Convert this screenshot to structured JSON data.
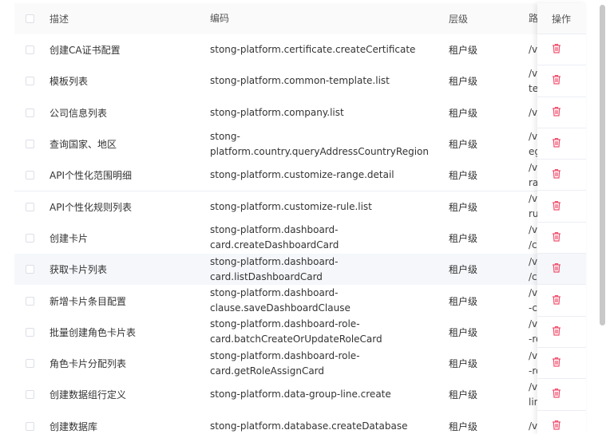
{
  "columns": {
    "description": "描述",
    "code": "编码",
    "level": "层级",
    "path": "路",
    "action": "操作"
  },
  "icons": {
    "delete": "trash-icon",
    "delete_color": "#f0506e"
  },
  "rows": [
    {
      "desc": "创建CA证书配置",
      "code": "stong-platform.certificate.createCertificate",
      "level": "租户级",
      "path": "/v"
    },
    {
      "desc": "模板列表",
      "code": "stong-platform.common-template.list",
      "level": "租户级",
      "path": "/v\nte"
    },
    {
      "desc": "公司信息列表",
      "code": "stong-platform.company.list",
      "level": "租户级",
      "path": "/v"
    },
    {
      "desc": "查询国家、地区",
      "code": "stong-\nplatform.country.queryAddressCountryRegion",
      "level": "租户级",
      "path": "/v\neg"
    },
    {
      "desc": "API个性化范围明细",
      "code": "stong-platform.customize-range.detail",
      "level": "租户级",
      "path": "/v\nra"
    },
    {
      "desc": "API个性化规则列表",
      "code": "stong-platform.customize-rule.list",
      "level": "租户级",
      "path": "/v\nru"
    },
    {
      "desc": "创建卡片",
      "code": "stong-platform.dashboard-\ncard.createDashboardCard",
      "level": "租户级",
      "path": "/v\n/ca"
    },
    {
      "desc": "获取卡片列表",
      "code": "stong-platform.dashboard-\ncard.listDashboardCard",
      "level": "租户级",
      "path": "/v\n/ca"
    },
    {
      "desc": "新增卡片条目配置",
      "code": "stong-platform.dashboard-\nclause.saveDashboardClause",
      "level": "租户级",
      "path": "/v\n-cl"
    },
    {
      "desc": "批量创建角色卡片表",
      "code": "stong-platform.dashboard-role-\ncard.batchCreateOrUpdateRoleCard",
      "level": "租户级",
      "path": "/v\n-ro"
    },
    {
      "desc": "角色卡片分配列表",
      "code": "stong-platform.dashboard-role-\ncard.getRoleAssignCard",
      "level": "租户级",
      "path": "/v\n-ro"
    },
    {
      "desc": "创建数据组行定义",
      "code": "stong-platform.data-group-line.create",
      "level": "租户级",
      "path": "/v\nlin"
    },
    {
      "desc": "创建数据库",
      "code": "stong-platform.database.createDatabase",
      "level": "租户级",
      "path": "/v"
    }
  ]
}
